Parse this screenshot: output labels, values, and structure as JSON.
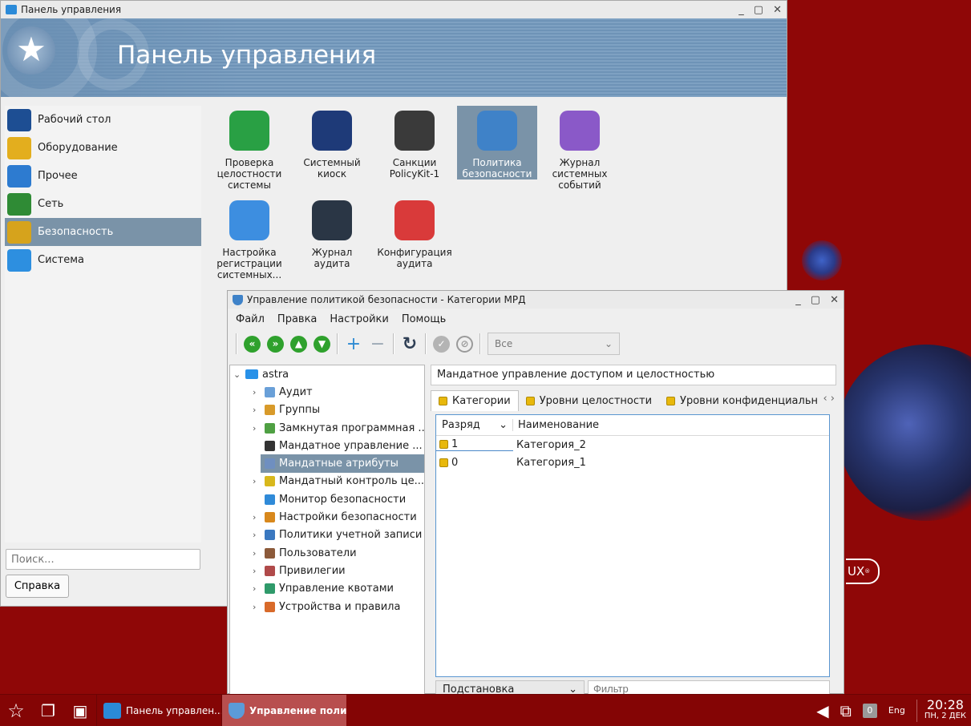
{
  "control_panel": {
    "title": "Панель управления",
    "banner_title": "Панель управления",
    "sidebar": [
      {
        "label": "Рабочий стол",
        "icon": "desktop-icon",
        "color": "#1d4e93"
      },
      {
        "label": "Оборудование",
        "icon": "hardware-icon",
        "color": "#e3ae1e"
      },
      {
        "label": "Прочее",
        "icon": "misc-icon",
        "color": "#2d7bd0"
      },
      {
        "label": "Сеть",
        "icon": "network-icon",
        "color": "#2f8b35"
      },
      {
        "label": "Безопасность",
        "icon": "security-icon",
        "color": "#d6a31c",
        "selected": true
      },
      {
        "label": "Система",
        "icon": "system-gear-icon",
        "color": "#2d8fe0"
      }
    ],
    "apps": [
      {
        "label": "Проверка целостности системы",
        "icon": "integrity-check-icon"
      },
      {
        "label": "Системный киоск",
        "icon": "kiosk-icon"
      },
      {
        "label": "Санкции PolicyKit-1",
        "icon": "policykit-icon"
      },
      {
        "label": "Политика безопасности",
        "icon": "security-policy-icon",
        "selected": true
      },
      {
        "label": "Журнал системных событий",
        "icon": "event-log-icon"
      },
      {
        "label": "Настройка регистрации системных...",
        "icon": "log-settings-icon"
      },
      {
        "label": "Журнал аудита",
        "icon": "audit-log-icon"
      },
      {
        "label": "Конфигурация аудита",
        "icon": "audit-config-icon"
      }
    ],
    "search_placeholder": "Поиск...",
    "help_label": "Справка"
  },
  "security_window": {
    "title": "Управление политикой безопасности - Категории МРД",
    "menu": [
      "Файл",
      "Правка",
      "Настройки",
      "Помощь"
    ],
    "filter_combo": "Все",
    "tree_root": "astra",
    "tree": [
      {
        "label": "Аудит",
        "icon": "audit-icon",
        "color": "#6aa0d8",
        "expandable": true
      },
      {
        "label": "Группы",
        "icon": "groups-icon",
        "color": "#d89a2a",
        "expandable": true
      },
      {
        "label": "Замкнутая программная ...",
        "icon": "closed-software-icon",
        "color": "#4fa043",
        "expandable": true
      },
      {
        "label": "Мандатное управление ...",
        "icon": "mandatory-access-icon",
        "color": "#333333",
        "expandable": false
      },
      {
        "label": "Мандатные атрибуты",
        "icon": "mandatory-attributes-icon",
        "color": "#6f8fc0",
        "expandable": false,
        "selected": true
      },
      {
        "label": "Мандатный контроль це...",
        "icon": "mandatory-integrity-icon",
        "color": "#d8b81c",
        "expandable": true
      },
      {
        "label": "Монитор безопасности",
        "icon": "security-monitor-icon",
        "color": "#2f8ad8",
        "expandable": false
      },
      {
        "label": "Настройки безопасности",
        "icon": "security-settings-icon",
        "color": "#d8881c",
        "expandable": true
      },
      {
        "label": "Политики учетной записи",
        "icon": "account-policy-icon",
        "color": "#3a78c0",
        "expandable": true
      },
      {
        "label": "Пользователи",
        "icon": "users-icon",
        "color": "#8c5a3a",
        "expandable": true
      },
      {
        "label": "Привилегии",
        "icon": "privileges-icon",
        "color": "#b04a4a",
        "expandable": true
      },
      {
        "label": "Управление квотами",
        "icon": "quota-icon",
        "color": "#2f9a6a",
        "expandable": true
      },
      {
        "label": "Устройства и правила",
        "icon": "devices-rules-icon",
        "color": "#d86a2a",
        "expandable": true
      }
    ],
    "header_text": "Мандатное управление доступом и целостностью",
    "tabs": [
      "Категории",
      "Уровни целостности",
      "Уровни конфиденциальн"
    ],
    "columns": [
      "Разряд",
      "Наименование"
    ],
    "rows": [
      {
        "bit": "1",
        "name": "Категория_2"
      },
      {
        "bit": "0",
        "name": "Категория_1"
      }
    ],
    "substitution_label": "Подстановка",
    "filter_placeholder": "Фильтр"
  },
  "desktop": {
    "logo_text": "UX",
    "logo_mark": "®"
  },
  "taskbar": {
    "tasks": [
      {
        "label": "Панель управлен...",
        "active": false
      },
      {
        "label": "Управление поли...",
        "active": true
      }
    ],
    "indicator_count": "0",
    "language": "Eng",
    "time": "20:28",
    "date": "ПН, 2 ДЕК"
  }
}
